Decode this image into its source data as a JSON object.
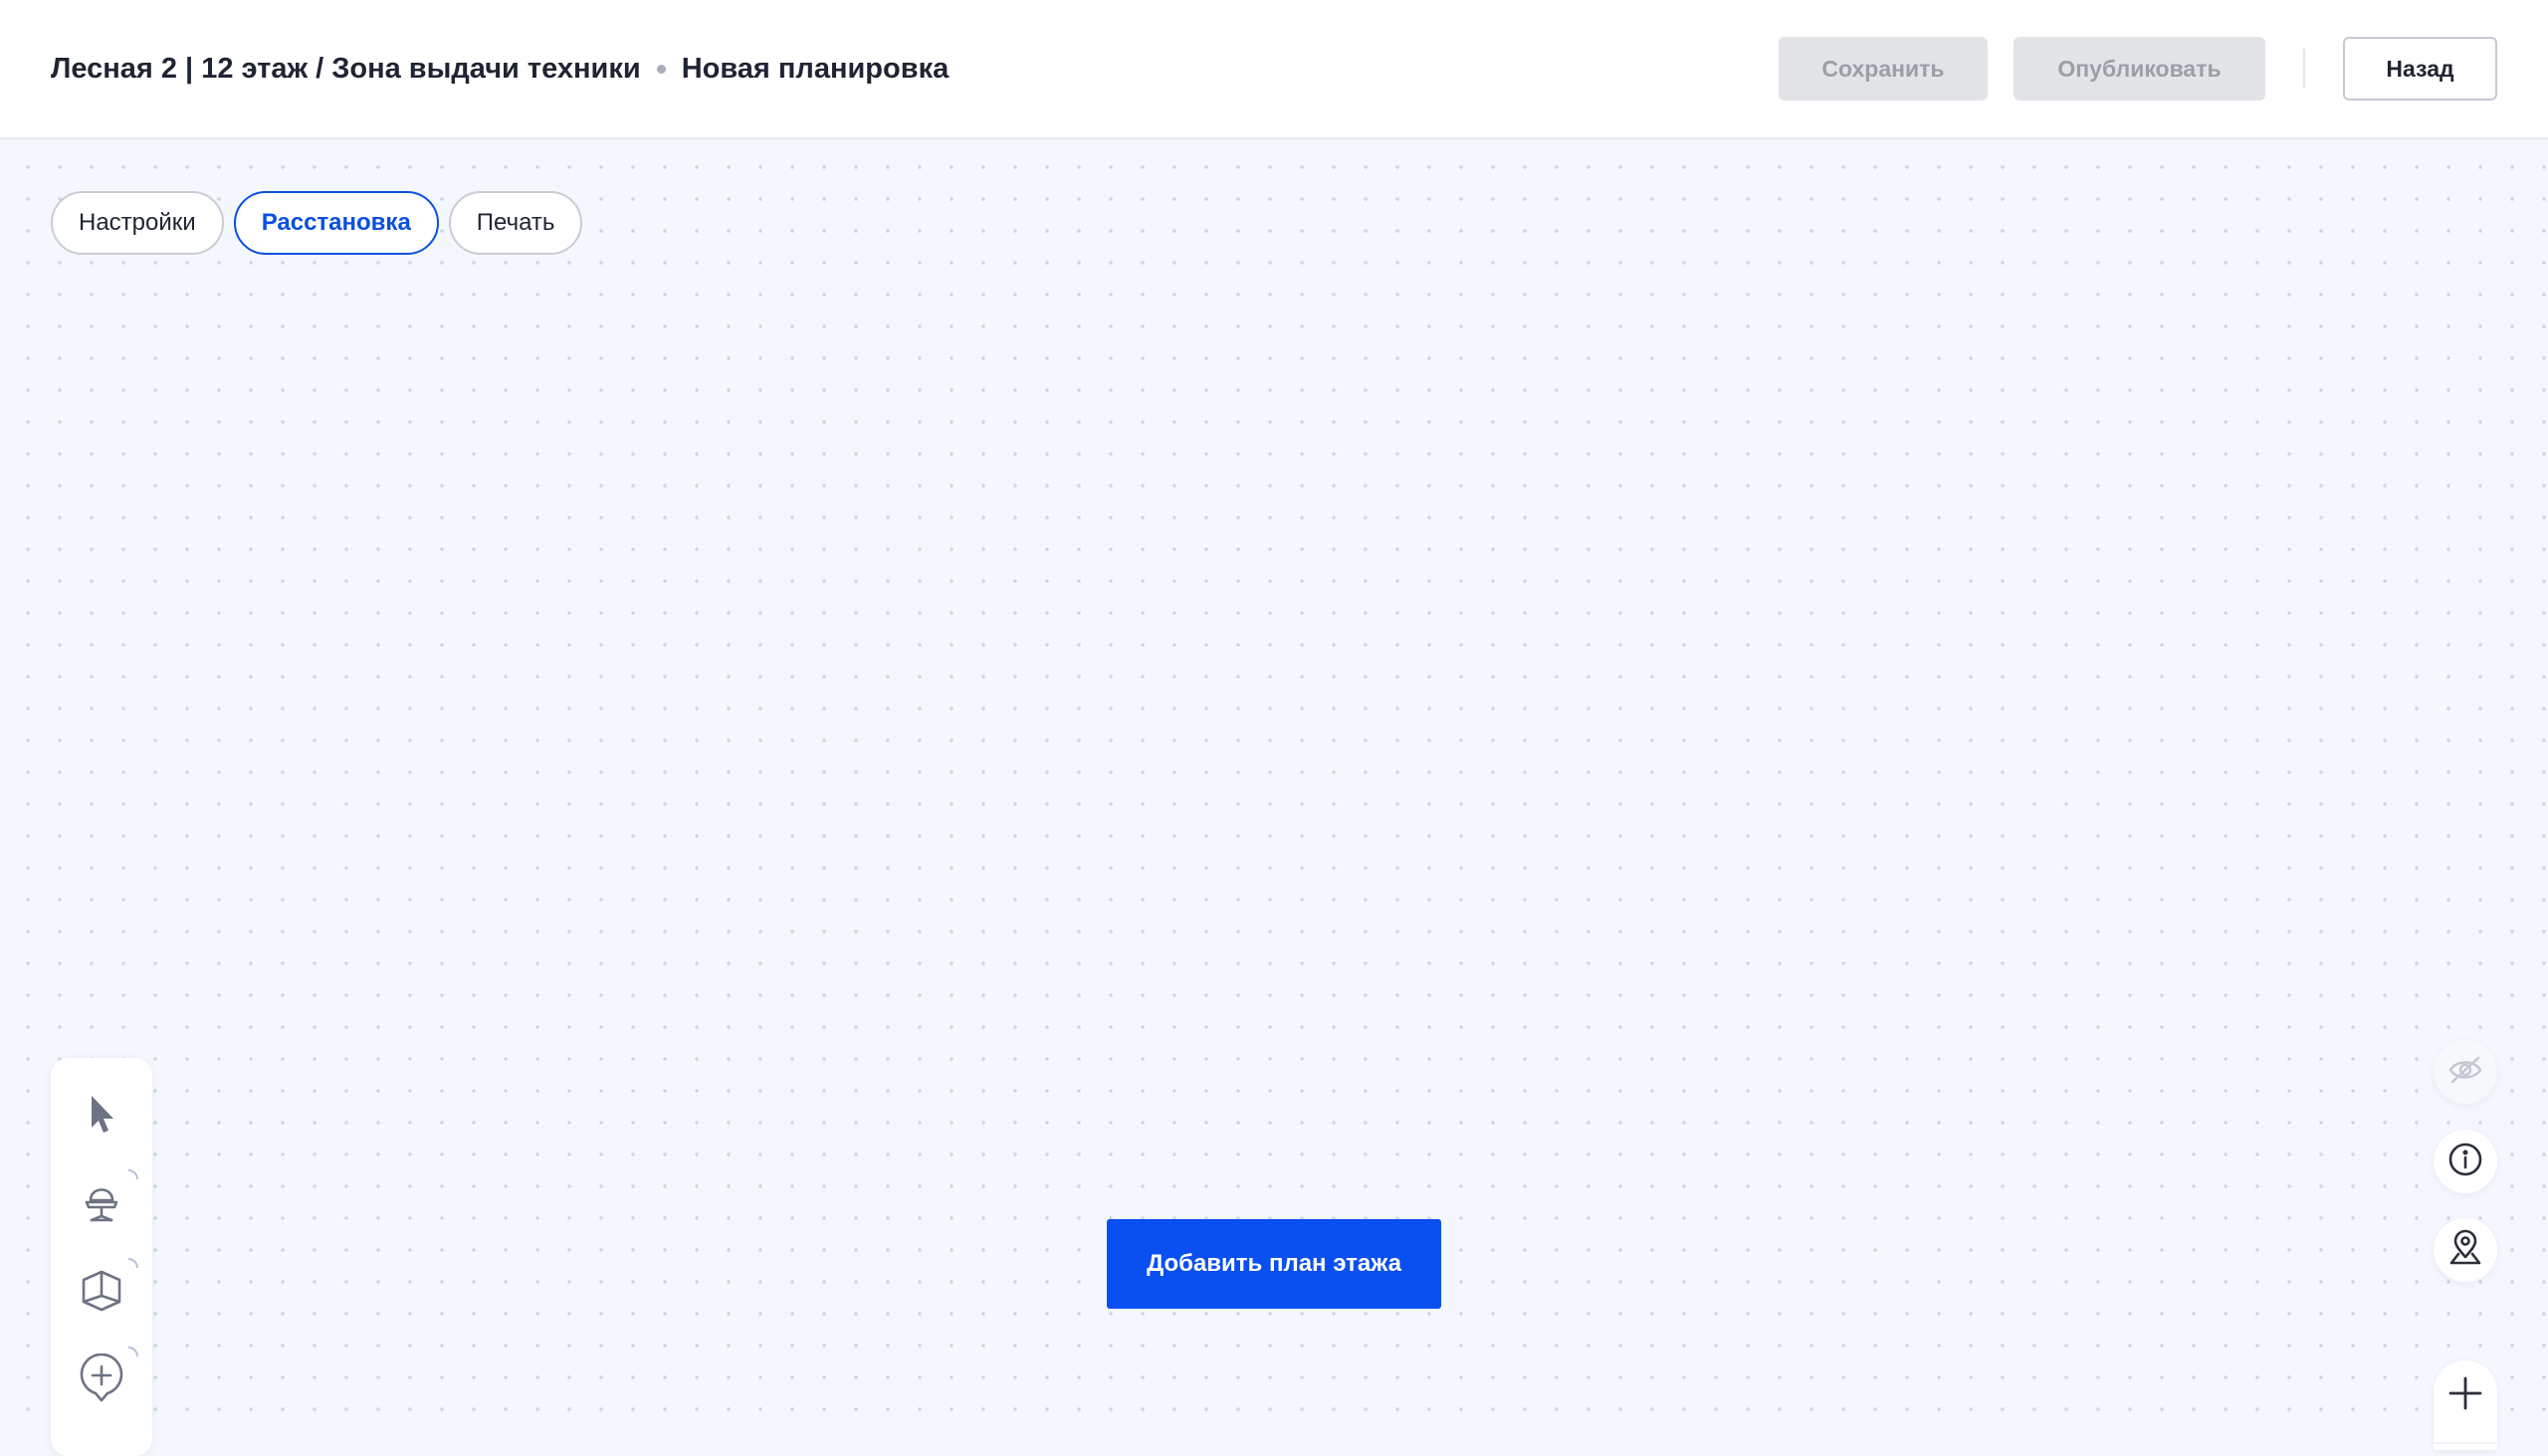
{
  "header": {
    "breadcrumb_path": "Лесная 2 | 12 этаж / Зона выдачи техники",
    "plan_name": "Новая планировка",
    "save_label": "Сохранить",
    "publish_label": "Опубликовать",
    "back_label": "Назад"
  },
  "tabs": [
    {
      "label": "Настройки",
      "active": false
    },
    {
      "label": "Расстановка",
      "active": true
    },
    {
      "label": "Печать",
      "active": false
    }
  ],
  "toolbar": {
    "tools": [
      {
        "icon": "cursor-icon"
      },
      {
        "icon": "chair-icon"
      },
      {
        "icon": "room-cube-icon"
      },
      {
        "icon": "add-marker-icon"
      }
    ]
  },
  "canvas": {
    "add_floor_plan_label": "Добавить план этажа"
  },
  "right_controls": {
    "icons": [
      "eye-off-icon",
      "info-icon",
      "location-pin-icon",
      "zoom-in-icon"
    ]
  },
  "colors": {
    "accent": "#0a4fef",
    "canvas_bg": "#f4f7fd",
    "disabled_bg": "#e2e4e8",
    "disabled_text": "#9c9fa6"
  }
}
